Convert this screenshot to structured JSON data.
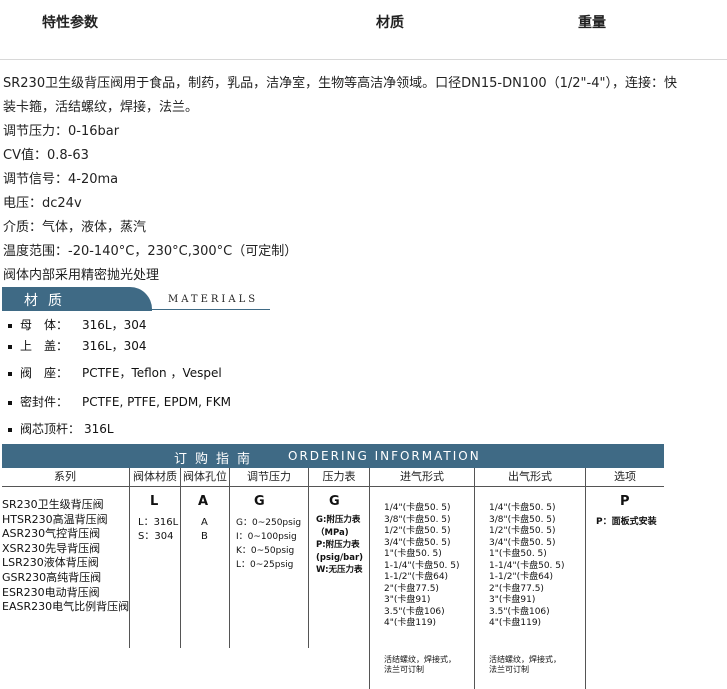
{
  "header": {
    "specs": "特性参数",
    "material": "材质",
    "weight": "重量"
  },
  "description": [
    "SR230卫生级背压阀用于食品，制药，乳品，洁净室，生物等高洁净领域。口径DN15-DN100（1/2\"-4\"），连接：快",
    "装卡箍，活结螺纹，焊接，法兰。",
    "调节压力：0-16bar",
    "CV值：0.8-63",
    "调节信号：4-20ma",
    "电压：dc24v",
    "介质：气体，液体，蒸汽",
    "温度范围：-20-140°C，230°C,300°C（可定制）",
    "阀体内部采用精密抛光处理"
  ],
  "materials": {
    "title_zh": "材质",
    "title_en": "MATERIALS",
    "items": [
      {
        "label": "母　体：",
        "value": "316L，304"
      },
      {
        "label": "上　盖：",
        "value": "316L，304"
      },
      {
        "label": "阀　座：",
        "value": "PCTFE，Teflon ，Vespel"
      },
      {
        "label": "密封件：",
        "value": "PCTFE, PTFE, EPDM, FKM"
      },
      {
        "label": "阀芯顶杆：",
        "value": "316L"
      }
    ]
  },
  "ordering": {
    "title_zh": "订购指南",
    "title_en": "ORDERING  INFORMATION",
    "columns": [
      "系列",
      "阀体材质",
      "阀体孔位",
      "调节压力",
      "压力表",
      "进气形式",
      "出气形式",
      "选项"
    ],
    "codes": {
      "material": "L",
      "port": "A",
      "pressure": "G",
      "gauge": "G",
      "option": "P"
    },
    "series": [
      "SR230卫生级背压阀",
      "HTSR230高温背压阀",
      "ASR230气控背压阀",
      "XSR230先导背压阀",
      "LSR230液体背压阀",
      "GSR230高纯背压阀",
      "ESR230电动背压阀",
      "EASR230电气比例背压阀"
    ],
    "material_opts": [
      "L：316L",
      "S：304"
    ],
    "port_opts": [
      "A",
      "B"
    ],
    "pressure_opts": [
      "G：0~250psig",
      "I：0~100psig",
      "K：0~50psig",
      "L：0~25psig"
    ],
    "gauge_opts": [
      "G:附压力表",
      "（MPa)",
      "P:附压力表",
      "(psig/bar)",
      "W:无压力表"
    ],
    "inlet_opts": [
      "1/4\"(卡盘50. 5)",
      "3/8\"(卡盘50. 5)",
      "1/2\"(卡盘50. 5)",
      "3/4\"(卡盘50. 5)",
      "1\"(卡盘50. 5)",
      "1-1/4\"(卡盘50. 5)",
      "1-1/2\"(卡盘64)",
      "2\"(卡盘77.5)",
      "3\"(卡盘91)",
      "3.5\"(卡盘106)",
      "4\"(卡盘119)"
    ],
    "outlet_opts": [
      "1/4\"(卡盘50. 5)",
      "3/8\"(卡盘50. 5)",
      "1/2\"(卡盘50. 5)",
      "3/4\"(卡盘50. 5)",
      "1\"(卡盘50. 5)",
      "1-1/4\"(卡盘50. 5)",
      "1-1/2\"(卡盘64)",
      "2\"(卡盘77.5)",
      "3\"(卡盘91)",
      "3.5\"(卡盘106)",
      "4\"(卡盘119)"
    ],
    "inlet_note": [
      "活结螺纹，焊接式，",
      "法兰可订制"
    ],
    "outlet_note": [
      "活结螺纹，焊接式，",
      "法兰可订制"
    ],
    "option_opts": [
      "P：面板式安装"
    ]
  }
}
